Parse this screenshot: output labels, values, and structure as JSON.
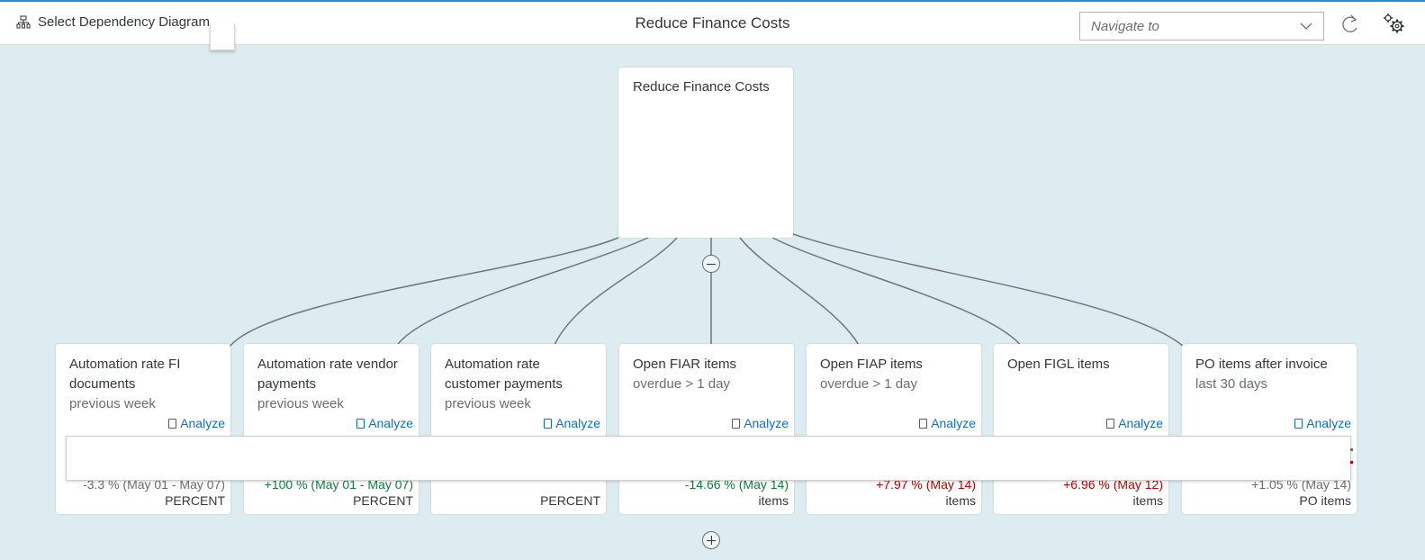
{
  "header": {
    "select_diagram_label": "Select Dependency Diagram",
    "title": "Reduce Finance Costs",
    "navigate_placeholder": "Navigate to"
  },
  "root": {
    "title": "Reduce Finance Costs"
  },
  "kpis": [
    {
      "title": "Automation rate FI documents",
      "subtitle": "previous week",
      "analyze": "Analyze",
      "delta": "-3.3 % (May 01 - May 07)",
      "unit": "PERCENT"
    },
    {
      "title": "Automation rate vendor payments",
      "subtitle": "previous week",
      "analyze": "Analyze",
      "delta": "+100 % (May 01 - May 07)",
      "unit": "PERCENT"
    },
    {
      "title": "Automation rate customer payments",
      "subtitle": "previous week",
      "analyze": "Analyze",
      "delta": "",
      "unit": "PERCENT"
    },
    {
      "title": "Open FIAR items",
      "subtitle": "overdue > 1 day",
      "analyze": "Analyze",
      "delta": "-14.66 % (May 14)",
      "unit": "items"
    },
    {
      "title": "Open FIAP items",
      "subtitle": "overdue > 1 day",
      "analyze": "Analyze",
      "delta": "+7.97 % (May 14)",
      "unit": "items"
    },
    {
      "title": "Open FIGL items",
      "subtitle": "",
      "analyze": "Analyze",
      "delta": "+6.96 % (May 12)",
      "unit": "items"
    },
    {
      "title": "PO items after invoice",
      "subtitle": "last 30 days",
      "analyze": "Analyze",
      "delta": "+1.05 % (May 14)",
      "unit": "PO items"
    }
  ],
  "colors": {
    "background": "#dcecf0",
    "accent": "#0a6ed1",
    "positive": "#107e3e",
    "negative": "#bb0000"
  }
}
